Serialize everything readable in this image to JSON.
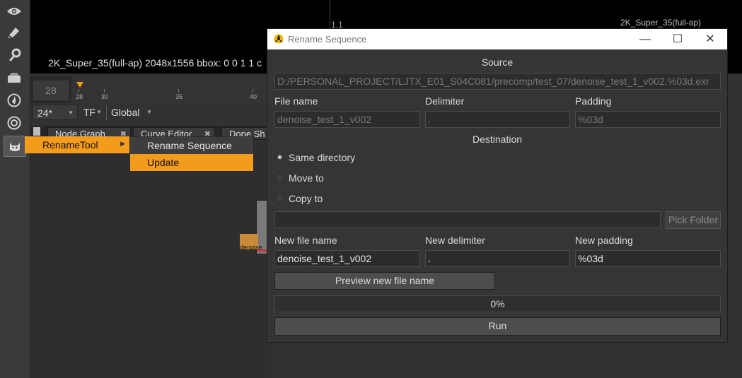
{
  "viewer": {
    "top_center_label": "1,1",
    "top_right_label": "2K_Super_35(full-ap)",
    "info_line": "2K_Super_35(full-ap) 2048x1556  bbox: 0 0 1 1 c"
  },
  "timeline": {
    "current_frame": "28",
    "ticks": [
      "28",
      "30",
      "35",
      "40"
    ]
  },
  "controls": {
    "fps": "24*",
    "tf": "TF",
    "scope": "Global"
  },
  "tabs": [
    "Node Graph",
    "Curve Editor",
    "Dope Sh"
  ],
  "node": {
    "label": "denoise"
  },
  "context_menu": {
    "root_item": "RenameTool",
    "sub_items": [
      "Rename Sequence",
      "Update"
    ],
    "highlighted": "Update"
  },
  "dialog": {
    "title": "Rename Sequence",
    "window_buttons": {
      "minimize": "—",
      "maximize": "☐",
      "close": "✕"
    },
    "source_heading": "Source",
    "source_path": "D:/PERSONAL_PROJECT/LJTX_E01_S04C081/precomp/test_07/denoise_test_1_v002.%03d.exr",
    "labels": {
      "file_name": "File name",
      "delimiter": "Delimiter",
      "padding": "Padding"
    },
    "source_values": {
      "file_name": "denoise_test_1_v002",
      "delimiter": ".",
      "padding": "%03d"
    },
    "destination_heading": "Destination",
    "radio_options": [
      "Same directory",
      "Move to",
      "Copy to"
    ],
    "selected_option": "Same directory",
    "folder_path": "",
    "pick_folder_label": "Pick Folder",
    "new_labels": {
      "file_name": "New file name",
      "delimiter": "New delimiter",
      "padding": "New padding"
    },
    "new_values": {
      "file_name": "denoise_test_1_v002",
      "delimiter": ".",
      "padding": "%03d"
    },
    "preview_button": "Preview new file name",
    "progress_text": "0%",
    "progress_value": 0,
    "run_button": "Run"
  },
  "colors": {
    "accent": "#f39c1c",
    "background": "#323232",
    "dialog_bg": "#353535"
  }
}
